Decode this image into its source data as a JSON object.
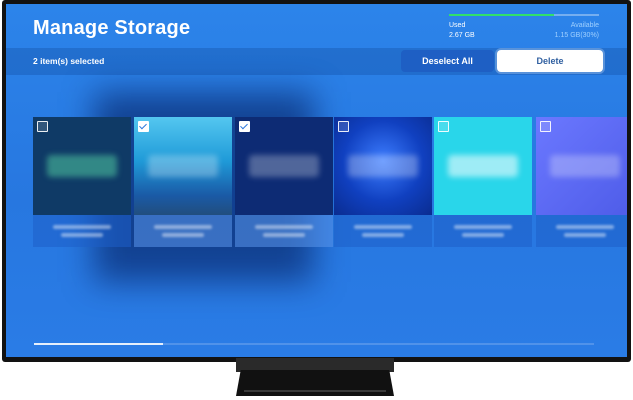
{
  "header": {
    "title": "Manage Storage",
    "used_label": "Used",
    "used_value": "2.67 GB",
    "available_label": "Available",
    "available_value": "1.15 GB(30%)",
    "usage_fraction": 0.7,
    "usage_color": "#31e06a"
  },
  "toolbar": {
    "selected_count": "2 item(s) selected",
    "deselect_label": "Deselect All",
    "delete_label": "Delete"
  },
  "tiles": [
    {
      "checked": false,
      "art_color": "#0f3a66",
      "icon": "app-tile-icon"
    },
    {
      "checked": true,
      "art_color": "#1c8fd6",
      "icon": "app-tile-icon"
    },
    {
      "checked": true,
      "art_color": "#0d2b74",
      "icon": "app-tile-icon"
    },
    {
      "checked": false,
      "art_color": "#1147c8",
      "icon": "app-tile-icon"
    },
    {
      "checked": false,
      "art_color": "#29d6ea",
      "icon": "app-tile-icon"
    },
    {
      "checked": false,
      "art_color": "#5a66f0",
      "icon": "app-tile-icon"
    }
  ],
  "scroll": {
    "position_fraction": 0.0,
    "visible_fraction": 0.23
  }
}
